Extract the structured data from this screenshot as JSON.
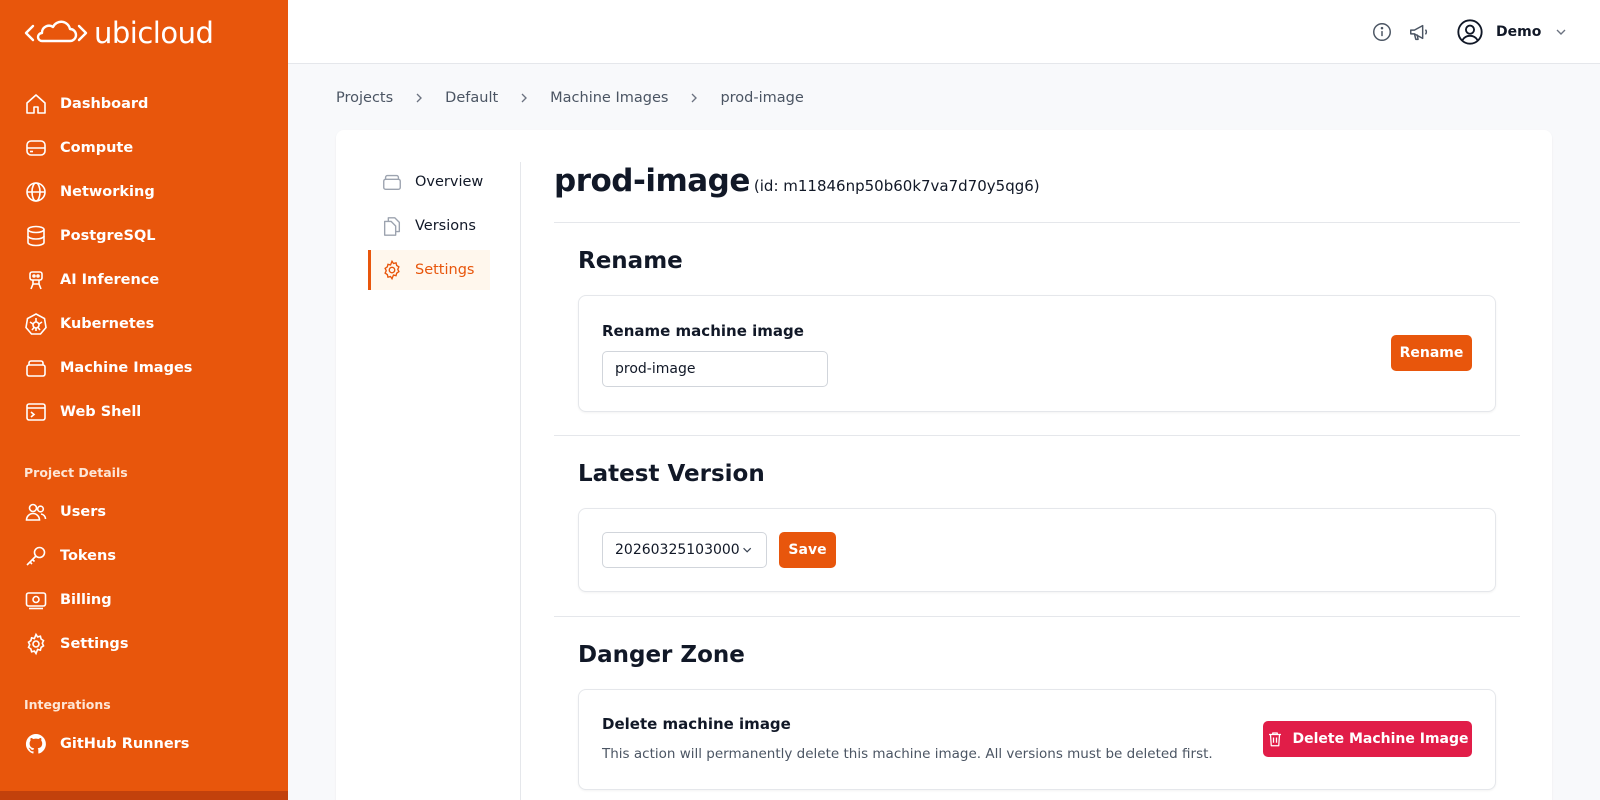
{
  "brand": {
    "name": "ubicloud",
    "accent": "#e8560c",
    "danger": "#e11d48"
  },
  "sidebar": {
    "items": [
      {
        "label": "Dashboard",
        "icon": "home-icon"
      },
      {
        "label": "Compute",
        "icon": "server-icon"
      },
      {
        "label": "Networking",
        "icon": "globe-icon"
      },
      {
        "label": "PostgreSQL",
        "icon": "database-icon"
      },
      {
        "label": "AI Inference",
        "icon": "robot-icon"
      },
      {
        "label": "Kubernetes",
        "icon": "kubernetes-icon"
      },
      {
        "label": "Machine Images",
        "icon": "stack-icon"
      },
      {
        "label": "Web Shell",
        "icon": "terminal-icon"
      }
    ],
    "project_section_label": "Project Details",
    "project_items": [
      {
        "label": "Users",
        "icon": "users-icon"
      },
      {
        "label": "Tokens",
        "icon": "key-icon"
      },
      {
        "label": "Billing",
        "icon": "banknote-icon"
      },
      {
        "label": "Settings",
        "icon": "gear-icon"
      }
    ],
    "integrations_section_label": "Integrations",
    "integration_items": [
      {
        "label": "GitHub Runners",
        "icon": "github-icon"
      }
    ]
  },
  "topbar": {
    "user_name": "Demo"
  },
  "breadcrumb": [
    "Projects",
    "Default",
    "Machine Images",
    "prod-image"
  ],
  "subnav": [
    {
      "label": "Overview",
      "icon": "stack-icon"
    },
    {
      "label": "Versions",
      "icon": "documents-icon"
    },
    {
      "label": "Settings",
      "icon": "gear-icon",
      "active": true
    }
  ],
  "page": {
    "title": "prod-image",
    "id_text": "(id: m11846np50b60k7va7d70y5qg6)"
  },
  "rename": {
    "heading": "Rename",
    "label": "Rename machine image",
    "value": "prod-image",
    "button": "Rename"
  },
  "latest_version": {
    "heading": "Latest Version",
    "selected": "20260325103000",
    "button": "Save"
  },
  "danger": {
    "heading": "Danger Zone",
    "label": "Delete machine image",
    "help": "This action will permanently delete this machine image. All versions must be deleted first.",
    "button": "Delete Machine Image"
  }
}
